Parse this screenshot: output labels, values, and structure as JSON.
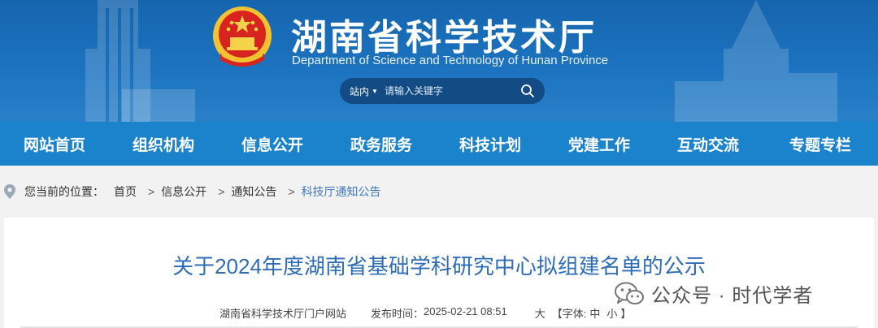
{
  "header": {
    "title": "湖南省科学技术厅",
    "subtitle": "Department of Science and Technology of Hunan Province",
    "search": {
      "scope": "站内",
      "placeholder": "请输入关键字"
    }
  },
  "nav": {
    "items": [
      {
        "label": "网站首页"
      },
      {
        "label": "组织机构"
      },
      {
        "label": "信息公开"
      },
      {
        "label": "政务服务"
      },
      {
        "label": "科技计划"
      },
      {
        "label": "党建工作"
      },
      {
        "label": "互动交流"
      },
      {
        "label": "专题专栏"
      }
    ]
  },
  "breadcrumb": {
    "prefix": "您当前的位置：",
    "items": [
      "首页",
      "信息公开",
      "通知公告",
      "科技厅通知公告"
    ],
    "separator": ">"
  },
  "article": {
    "title": "关于2024年度湖南省基础学科研究中心拟组建名单的公示",
    "source": "湖南省科学技术厅门户网站",
    "publish_label": "发布时间：",
    "publish_time": "2025-02-21 08:51",
    "font_size_large": "大",
    "font_label_open": "【字体:",
    "font_size_medium": "中",
    "font_size_small": "小",
    "font_label_close": "】"
  },
  "watermark": {
    "text": "公众号 · 时代学者"
  },
  "colors": {
    "header_bg": "#1565ae",
    "nav_bg": "#1b82cc",
    "title_blue": "#2e6db5",
    "link_blue": "#3d78bf"
  }
}
